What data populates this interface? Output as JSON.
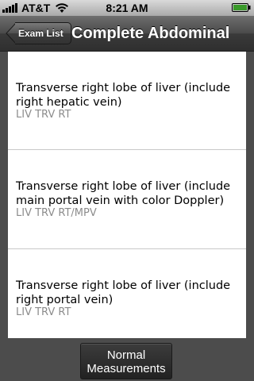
{
  "status_bar": {
    "carrier": "AT&T",
    "time": "8:21 AM"
  },
  "nav": {
    "back_label": "Exam List",
    "title": "Complete Abdominal"
  },
  "items": [
    {
      "title_line1": "Transverse right lobe of liver (include",
      "title_line2": "right hepatic vein)",
      "code": "LIV TRV RT"
    },
    {
      "title_line1": "Transverse right lobe of liver (include",
      "title_line2": "main portal vein with color Doppler)",
      "code": "LIV TRV RT/MPV"
    },
    {
      "title_line1": "Transverse right lobe of liver (include",
      "title_line2": "right portal vein)",
      "code": "LIV TRV RT"
    }
  ],
  "bottom": {
    "button_line1": "Normal",
    "button_line2": "Measurements"
  },
  "colors": {
    "nav_bar": "#3a3a3a",
    "background": "#4c4c4c",
    "code_text": "#8c8c8c"
  }
}
